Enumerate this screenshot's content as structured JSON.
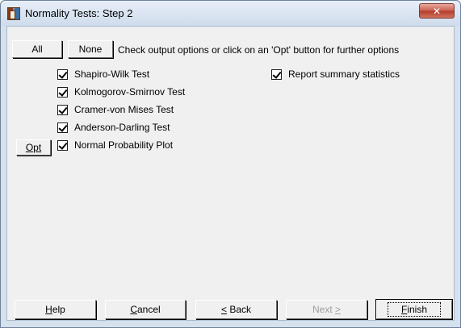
{
  "window": {
    "title": "Normality Tests: Step 2",
    "close_glyph": "✕"
  },
  "top_bar": {
    "all_label": "All",
    "none_label": "None",
    "instruction": "Check output options or click on an 'Opt' button for further options"
  },
  "tests": [
    {
      "label": "Shapiro-Wilk Test",
      "checked": true
    },
    {
      "label": "Kolmogorov-Smirnov Test",
      "checked": true
    },
    {
      "label": "Cramer-von Mises Test",
      "checked": true
    },
    {
      "label": "Anderson-Darling Test",
      "checked": true
    },
    {
      "label": "Normal Probability Plot",
      "checked": true
    }
  ],
  "opt_label": "Opt",
  "summary": {
    "label": "Report summary statistics",
    "checked": true
  },
  "footer": {
    "help": {
      "pre": "",
      "key": "H",
      "post": "elp",
      "enabled": true
    },
    "cancel": {
      "pre": "",
      "key": "C",
      "post": "ancel",
      "enabled": true
    },
    "back": {
      "pre": "",
      "key": "<",
      "post": " Back",
      "enabled": true
    },
    "next": {
      "pre": "Next ",
      "key": ">",
      "post": "",
      "enabled": false
    },
    "finish": {
      "pre": "",
      "key": "F",
      "post": "inish",
      "enabled": true,
      "default": true
    }
  }
}
